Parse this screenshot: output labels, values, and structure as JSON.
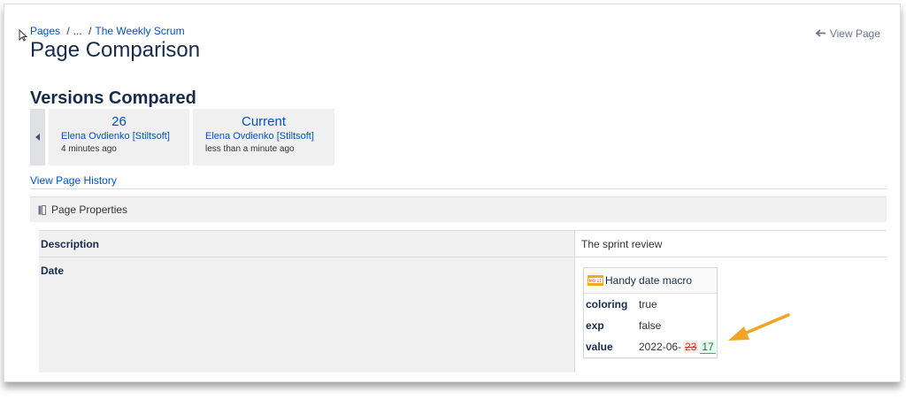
{
  "breadcrumb": {
    "root": "Pages",
    "sep1": "/",
    "ellipsis": "...",
    "sep2": "/",
    "current": "The Weekly Scrum"
  },
  "header": {
    "title": "Page Comparison",
    "view_page": "View Page"
  },
  "versions": {
    "heading": "Versions Compared",
    "items": [
      {
        "number": "26",
        "author": "Elena Ovdienko [Stiltsoft]",
        "time": "4 minutes ago"
      },
      {
        "number": "Current",
        "author": "Elena Ovdienko [Stiltsoft]",
        "time": "less than a minute ago"
      }
    ],
    "history_link": "View Page History"
  },
  "section": {
    "title": "Page Properties"
  },
  "properties": [
    {
      "key": "Description",
      "value": "The sprint review"
    },
    {
      "key": "Date",
      "value": ""
    }
  ],
  "macro": {
    "title": "Handy date macro",
    "icon_text": "MO 11",
    "params": [
      {
        "key": "coloring",
        "value": "true"
      },
      {
        "key": "exp",
        "value": "false"
      }
    ],
    "value_key": "value",
    "value_prefix": "2022-06-",
    "value_deleted": "23",
    "value_inserted": "17"
  },
  "colors": {
    "link": "#0052cc",
    "arrow": "#f0a526",
    "deleted": "#c9372c",
    "inserted": "#1f7a3f"
  }
}
